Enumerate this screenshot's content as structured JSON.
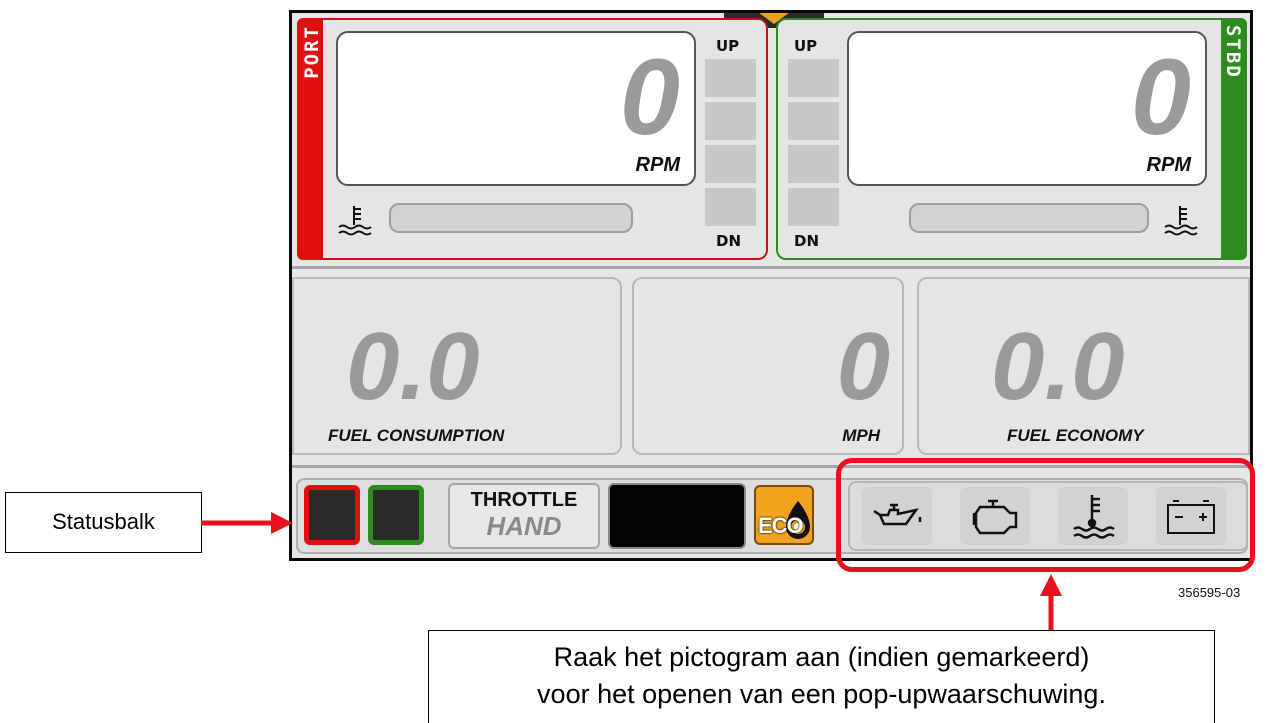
{
  "engines": {
    "port": {
      "label": "PORT",
      "rpm_value": "0",
      "rpm_unit": "RPM",
      "trim_up": "UP",
      "trim_down": "DN",
      "color": "#e01010"
    },
    "stbd": {
      "label": "STBD",
      "rpm_value": "0",
      "rpm_unit": "RPM",
      "trim_up": "UP",
      "trim_down": "DN",
      "color": "#2e8b1f"
    }
  },
  "gauges": {
    "fuel_consumption": {
      "value": "0.0",
      "label": "FUEL CONSUMPTION"
    },
    "speed": {
      "value": "0",
      "label": "MPH"
    },
    "fuel_economy": {
      "value": "0.0",
      "label": "FUEL ECONOMY"
    }
  },
  "status_bar": {
    "throttle_line1": "THROTTLE",
    "throttle_line2": "HAND",
    "eco_label": "ECO",
    "warning_icons": [
      "oil-pressure-icon",
      "check-engine-icon",
      "engine-temperature-icon",
      "battery-icon"
    ]
  },
  "annotations": {
    "statusbar_label": "Statusbalk",
    "callout_line1": "Raak het pictogram aan (indien gemarkeerd)",
    "callout_line2": "voor het openen van een pop-upwaarschuwing.",
    "figure_id": "356595-03",
    "highlight_color": "#e8101a"
  }
}
